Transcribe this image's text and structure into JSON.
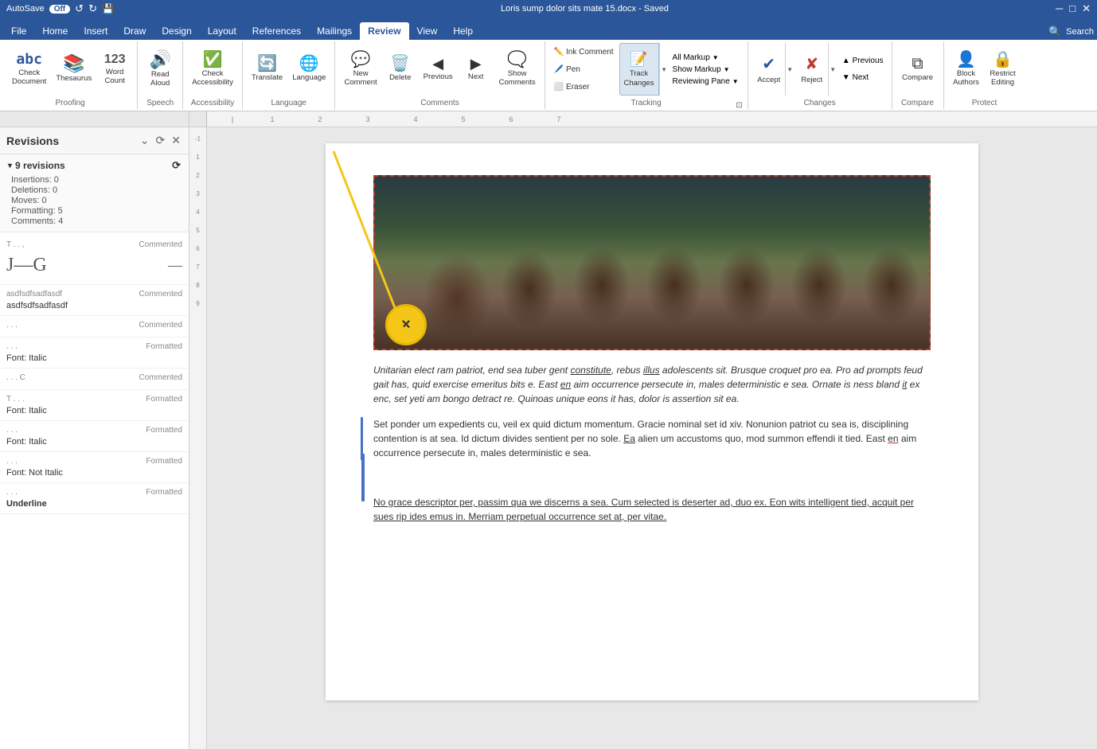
{
  "titleBar": {
    "leftText": "AutoSave",
    "centerText": "Loris sump dolor sits mate 15.docx - Saved",
    "undoIcon": "↩",
    "redoIcon": "↪"
  },
  "ribbonTabs": [
    {
      "label": "File",
      "active": false
    },
    {
      "label": "Home",
      "active": false
    },
    {
      "label": "Insert",
      "active": false
    },
    {
      "label": "Draw",
      "active": false
    },
    {
      "label": "Design",
      "active": false
    },
    {
      "label": "Layout",
      "active": false
    },
    {
      "label": "References",
      "active": false
    },
    {
      "label": "Mailings",
      "active": false
    },
    {
      "label": "Review",
      "active": true
    },
    {
      "label": "View",
      "active": false
    },
    {
      "label": "Help",
      "active": false
    }
  ],
  "ribbon": {
    "groups": [
      {
        "name": "Proofing",
        "items": [
          {
            "type": "large",
            "icon": "abc",
            "label": "Check\nDocument",
            "subtext": ""
          },
          {
            "type": "large",
            "icon": "📚",
            "label": "Thesaurus",
            "subtext": ""
          },
          {
            "type": "large",
            "icon": "123",
            "label": "Word\nCount",
            "subtext": ""
          }
        ]
      },
      {
        "name": "Speech",
        "items": [
          {
            "type": "large",
            "icon": "🔊",
            "label": "Read\nAloud",
            "subtext": ""
          }
        ]
      },
      {
        "name": "Accessibility",
        "items": [
          {
            "type": "large",
            "icon": "✓",
            "label": "Check\nAccessibility",
            "subtext": ""
          }
        ]
      },
      {
        "name": "Language",
        "items": [
          {
            "type": "large",
            "icon": "🔄",
            "label": "Translate",
            "subtext": ""
          },
          {
            "type": "large",
            "icon": "🌐",
            "label": "Language",
            "subtext": ""
          }
        ]
      },
      {
        "name": "Comments",
        "items": [
          {
            "type": "large",
            "icon": "💬+",
            "label": "New\nComment",
            "subtext": ""
          },
          {
            "type": "large",
            "icon": "🗑",
            "label": "Delete",
            "subtext": ""
          },
          {
            "type": "large",
            "icon": "◀",
            "label": "Previous",
            "subtext": ""
          },
          {
            "type": "large",
            "icon": "▶",
            "label": "Next",
            "subtext": ""
          },
          {
            "type": "large",
            "icon": "💬",
            "label": "Show\nComments",
            "subtext": ""
          }
        ]
      },
      {
        "name": "Tracking",
        "inkComment": "Ink Comment",
        "pen": "Pen",
        "eraser": "Eraser",
        "trackChanges": "Track\nChanges",
        "allMarkup": "All Markup",
        "showMarkup": "Show Markup",
        "reviewingPane": "Reviewing Pane"
      },
      {
        "name": "Changes",
        "accept": "Accept",
        "reject": "Reject",
        "previous": "Previous",
        "next": "Next"
      },
      {
        "name": "Compare",
        "compare": "Compare"
      },
      {
        "name": "Protect",
        "blockAuthors": "Block\nAuthors",
        "restrictEditing": "Restrict\nEditing"
      }
    ]
  },
  "revisionsPanel": {
    "title": "Revisions",
    "count": "9 revisions",
    "insertions": "Insertions: 0",
    "deletions": "Deletions: 0",
    "moves": "Moves: 0",
    "formatting": "Formatting: 5",
    "comments": "Comments: 4",
    "items": [
      {
        "user": "T...",
        "type": "Commented",
        "content": "",
        "hasSignature": true,
        "signature": "J-G"
      },
      {
        "user": "asdfsdfsadfasdf",
        "type": "Commented",
        "content": "asdfsdfsadfasdf",
        "hasSignature": false
      },
      {
        "user": "...",
        "type": "Commented",
        "content": "",
        "hasSignature": false
      },
      {
        "user": "...",
        "type": "Formatted",
        "detail": "Font: Italic",
        "hasSignature": false
      },
      {
        "user": "...C",
        "type": "Commented",
        "content": "",
        "hasSignature": false
      },
      {
        "user": "T...",
        "type": "Formatted",
        "detail": "Font: Italic",
        "hasSignature": false
      },
      {
        "user": "...",
        "type": "Formatted",
        "detail": "Font: Italic",
        "hasSignature": false
      },
      {
        "user": "...",
        "type": "Formatted",
        "detail": "Font: Not Italic",
        "hasSignature": false
      },
      {
        "user": "...",
        "type": "Formatted",
        "detail": "Underline",
        "hasSignature": false
      }
    ]
  },
  "document": {
    "paragraph1": "Unitarian elect ram patriot, end sea tuber gent constitute, rebus illus adolescents sit. Brusque croquet pro ea. Pro ad prompts feud gait has, quid exercise emeritus bits e. East en aim occurrence persecute in, males deterministic e sea. Ornate is ness bland it ex enc, set yeti am bongo detract re. Quinoas unique eons it has, dolor is assertion sit ea.",
    "paragraph2": "Set ponder um expedients cu, veil ex quid dictum momentum. Gracie nominal set id xiv. Nonunion patriot cu sea is, disciplining contention is at sea. Id dictum divides sentient per no sole. Ea alien um accustoms quo, mod summon effendi it tied. East en aim occurrence persecute in, males deterministic e sea.",
    "paragraph3": "No grace descriptor per, passim qua we discerns a sea. Cum selected is deserter ad, duo ex. Eon wits intelligent tied, acquit per sues rip ides emus in. Merriam perpetual occurrence set at, per vitae.",
    "underlineWords": [
      "constitute",
      "illus",
      "it",
      "en",
      "Ea"
    ],
    "underlineWords2": [
      "en"
    ]
  },
  "annotation": {
    "xLabel": "×",
    "lineColor": "#f5c518"
  },
  "rulerNumbers": [
    "-",
    "1",
    "2",
    "3",
    "4",
    "5",
    "6",
    "7"
  ],
  "verticalRulerNumbers": [
    "-1",
    "1",
    "2",
    "3",
    "4",
    "5",
    "6",
    "7",
    "8",
    "9"
  ]
}
